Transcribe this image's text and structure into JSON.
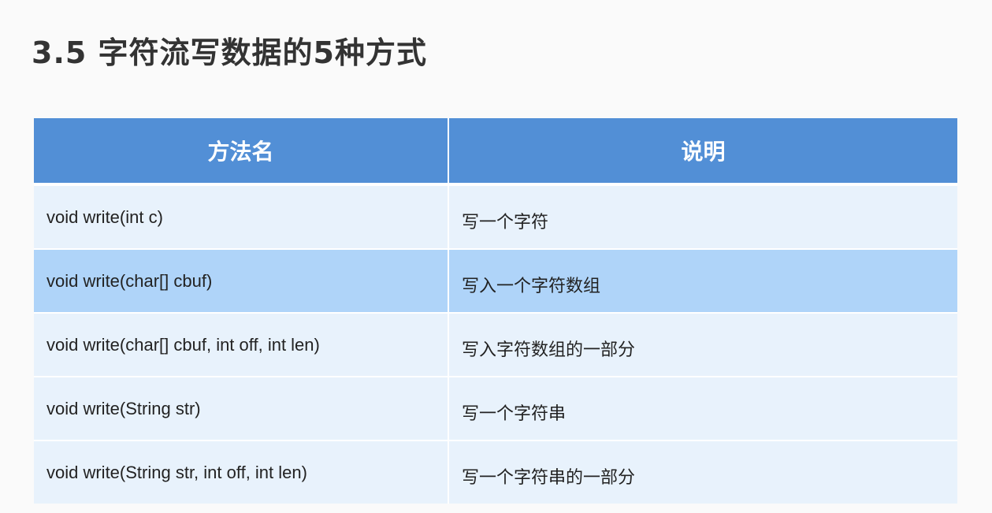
{
  "title": "3.5 字符流写数据的5种方式",
  "table": {
    "headers": [
      "方法名",
      "说明"
    ],
    "rows": [
      {
        "method": "void write(int c)",
        "desc": "写一个字符"
      },
      {
        "method": "void write(char[] cbuf)",
        "desc": "写入一个字符数组"
      },
      {
        "method": "void write(char[] cbuf, int off, int len)",
        "desc": "写入字符数组的一部分"
      },
      {
        "method": "void write(String str)",
        "desc": "写一个字符串"
      },
      {
        "method": "void write(String str, int off, int len)",
        "desc": "写一个字符串的一部分"
      }
    ]
  },
  "colors": {
    "header_bg": "#528fd6",
    "row_light": "#e8f2fc",
    "row_highlight": "#afd4f9",
    "title_text": "#333333"
  }
}
